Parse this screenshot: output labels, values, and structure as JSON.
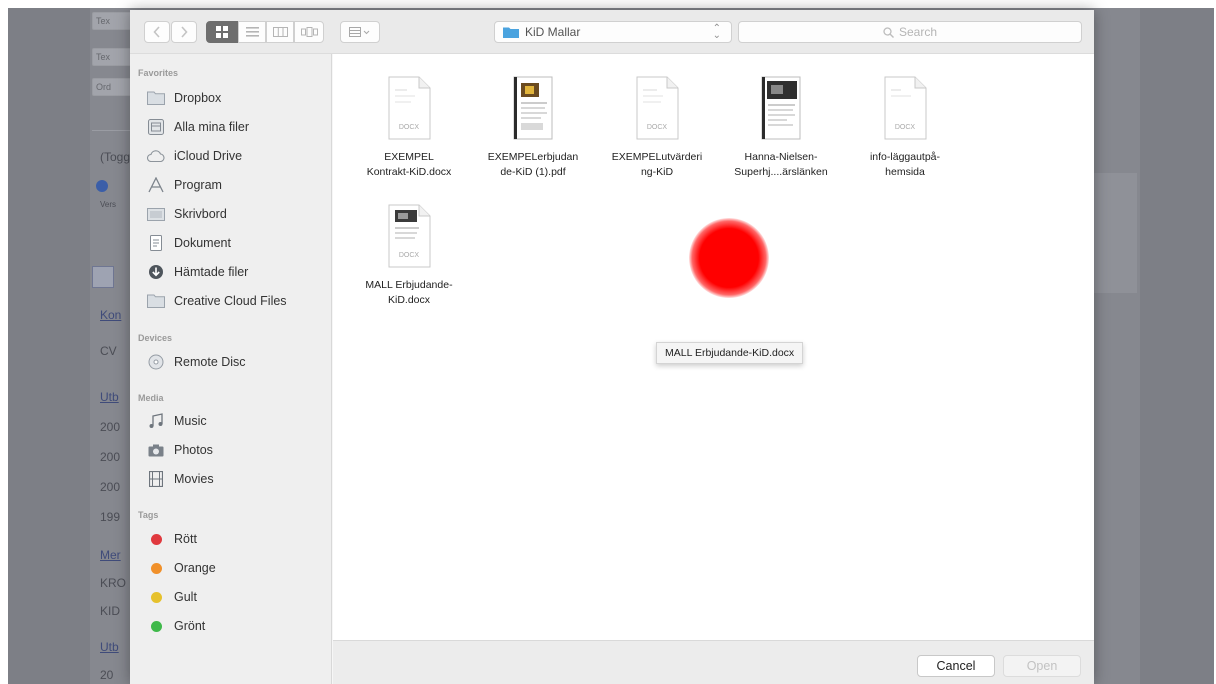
{
  "background_page": {
    "boxes": [
      "Tex",
      "Tex",
      "Ord"
    ],
    "lines": [
      "(Togg",
      "Vers",
      "Kon",
      "CV",
      "Utb",
      "200",
      "200",
      "200",
      "199",
      "Mer",
      "KRO",
      "KID",
      "Utb",
      "20"
    ]
  },
  "toolbar": {
    "path_label": "KiD Mallar",
    "search_placeholder": "Search"
  },
  "sidebar": {
    "sections": [
      {
        "label": "Favorites",
        "items": [
          {
            "label": "Dropbox",
            "icon": "folder-icon"
          },
          {
            "label": "Alla mina filer",
            "icon": "all-files-icon"
          },
          {
            "label": "iCloud Drive",
            "icon": "cloud-icon"
          },
          {
            "label": "Program",
            "icon": "applications-icon"
          },
          {
            "label": "Skrivbord",
            "icon": "desktop-folder-icon"
          },
          {
            "label": "Dokument",
            "icon": "documents-icon"
          },
          {
            "label": "Hämtade filer",
            "icon": "downloads-icon"
          },
          {
            "label": "Creative Cloud Files",
            "icon": "folder-icon"
          }
        ]
      },
      {
        "label": "Devices",
        "items": [
          {
            "label": "Remote Disc",
            "icon": "disc-icon"
          }
        ]
      },
      {
        "label": "Media",
        "items": [
          {
            "label": "Music",
            "icon": "music-icon"
          },
          {
            "label": "Photos",
            "icon": "camera-icon"
          },
          {
            "label": "Movies",
            "icon": "film-icon"
          }
        ]
      },
      {
        "label": "Tags",
        "items": [
          {
            "label": "Rött",
            "color": "#e0393e"
          },
          {
            "label": "Orange",
            "color": "#f0902a"
          },
          {
            "label": "Gult",
            "color": "#e6c12c"
          },
          {
            "label": "Grönt",
            "color": "#3fb94a"
          }
        ]
      }
    ]
  },
  "files": [
    {
      "name": "EXEMPEL\nKontrakt-KiD.docx",
      "kind": "docx",
      "badge": "DOCX"
    },
    {
      "name": "EXEMPELerbjudan\nde-KiD (1).pdf",
      "kind": "pdf-image",
      "badge": ""
    },
    {
      "name": "EXEMPELutvärderi\nng-KiD",
      "kind": "docx",
      "badge": "DOCX"
    },
    {
      "name": "Hanna-Nielsen-\nSuperhj....ärslänken",
      "kind": "pdf-image",
      "badge": ""
    },
    {
      "name": "info-läggautpå-\nhemsida",
      "kind": "docx",
      "badge": "DOCX"
    },
    {
      "name": "MALL Erbjudande-\nKiD.docx",
      "kind": "docx-image",
      "badge": "DOCX"
    }
  ],
  "tooltip": "MALL Erbjudande-KiD.docx",
  "buttons": {
    "cancel": "Cancel",
    "open": "Open"
  },
  "colors": {
    "click_marker": "#ff0000",
    "folder_blue": "#4aa3df"
  }
}
